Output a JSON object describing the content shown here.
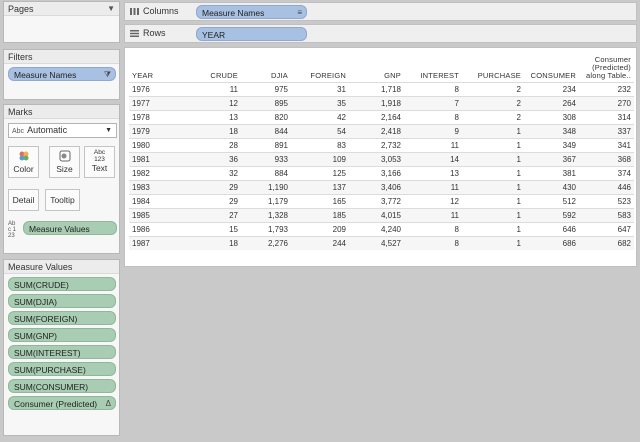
{
  "pages": {
    "title": "Pages"
  },
  "filters": {
    "title": "Filters",
    "pill": "Measure Names"
  },
  "marks": {
    "title": "Marks",
    "mark_type": "Automatic",
    "mark_type_prefix": "Abc",
    "buttons": {
      "color": "Color",
      "size": "Size",
      "text": "Text",
      "detail": "Detail",
      "tooltip": "Tooltip"
    },
    "text_badge": "Abc 123",
    "measure_values_pill": "Measure Values"
  },
  "measure_values": {
    "title": "Measure Values",
    "items": [
      "SUM(CRUDE)",
      "SUM(DJIA)",
      "SUM(FOREIGN)",
      "SUM(GNP)",
      "SUM(INTEREST)",
      "SUM(PURCHASE)",
      "SUM(CONSUMER)",
      "Consumer (Predicted)"
    ],
    "last_item_symbol": "Δ"
  },
  "columns_shelf": {
    "label": "Columns",
    "pill": "Measure Names"
  },
  "rows_shelf": {
    "label": "Rows",
    "pill": "YEAR"
  },
  "table": {
    "headers": [
      "YEAR",
      "CRUDE",
      "DJIA",
      "FOREIGN",
      "GNP",
      "INTEREST",
      "PURCHASE",
      "CONSUMER",
      "Consumer (Predicted) along Table.."
    ],
    "rows": [
      [
        "1976",
        "11",
        "975",
        "31",
        "1,718",
        "8",
        "2",
        "234",
        "232"
      ],
      [
        "1977",
        "12",
        "895",
        "35",
        "1,918",
        "7",
        "2",
        "264",
        "270"
      ],
      [
        "1978",
        "13",
        "820",
        "42",
        "2,164",
        "8",
        "2",
        "308",
        "314"
      ],
      [
        "1979",
        "18",
        "844",
        "54",
        "2,418",
        "9",
        "1",
        "348",
        "337"
      ],
      [
        "1980",
        "28",
        "891",
        "83",
        "2,732",
        "11",
        "1",
        "349",
        "341"
      ],
      [
        "1981",
        "36",
        "933",
        "109",
        "3,053",
        "14",
        "1",
        "367",
        "368"
      ],
      [
        "1982",
        "32",
        "884",
        "125",
        "3,166",
        "13",
        "1",
        "381",
        "374"
      ],
      [
        "1983",
        "29",
        "1,190",
        "137",
        "3,406",
        "11",
        "1",
        "430",
        "446"
      ],
      [
        "1984",
        "29",
        "1,179",
        "165",
        "3,772",
        "12",
        "1",
        "512",
        "523"
      ],
      [
        "1985",
        "27",
        "1,328",
        "185",
        "4,015",
        "11",
        "1",
        "592",
        "583"
      ],
      [
        "1986",
        "15",
        "1,793",
        "209",
        "4,240",
        "8",
        "1",
        "646",
        "647"
      ],
      [
        "1987",
        "18",
        "2,276",
        "244",
        "4,527",
        "8",
        "1",
        "686",
        "682"
      ]
    ]
  }
}
